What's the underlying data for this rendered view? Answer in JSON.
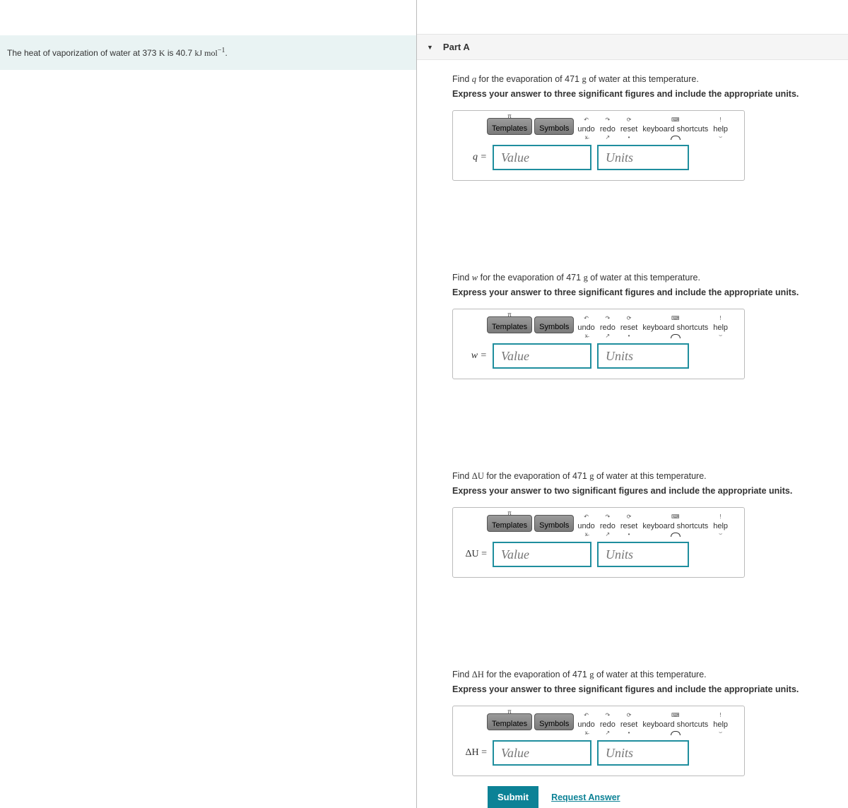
{
  "left": {
    "info_pre": "The heat of vaporization of water at 373 ",
    "info_k": "K",
    "info_mid": " is 40.7 ",
    "info_kj": "kJ mol",
    "info_exp": "−1",
    "info_end": "."
  },
  "part_header": {
    "label": "Part A"
  },
  "toolbar": {
    "templates": "Templates",
    "symbols": "Symbols",
    "undo": "undo",
    "redo": "redo",
    "reset": "reset",
    "keyboard": "keyboard shortcuts",
    "help": "help"
  },
  "placeholders": {
    "value": "Value",
    "units": "Units"
  },
  "questions": [
    {
      "p1": "Find ",
      "var": "q",
      "p2": " for the evaporation of 471 ",
      "g": "g",
      "p3": " of water at this temperature.",
      "instr": "Express your answer to three significant figures and include the appropriate units.",
      "lhs": "q ="
    },
    {
      "p1": "Find ",
      "var": "w",
      "p2": " for the evaporation of 471 ",
      "g": "g",
      "p3": " of water at this temperature.",
      "instr": "Express your answer to three significant figures and include the appropriate units.",
      "lhs": "w ="
    },
    {
      "p1": "Find ",
      "var": "ΔU",
      "p2": " for the evaporation of 471 ",
      "g": "g",
      "p3": " of water at this temperature.",
      "instr": "Express your answer to two significant figures and include the appropriate units.",
      "lhs": "ΔU ="
    },
    {
      "p1": "Find ",
      "var": "ΔH",
      "p2": " for the evaporation of 471 ",
      "g": "g",
      "p3": " of water at this temperature.",
      "instr": "Express your answer to three significant figures and include the appropriate units.",
      "lhs": "ΔH ="
    }
  ],
  "actions": {
    "submit": "Submit",
    "request": "Request Answer"
  }
}
